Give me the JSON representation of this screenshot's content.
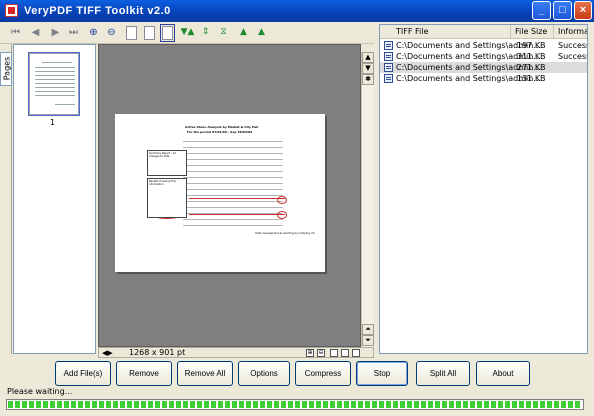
{
  "window": {
    "title": "VeryPDF TIFF Toolkit v2.0"
  },
  "side_tab": {
    "label": "Pages"
  },
  "thumbnail": {
    "page_number": "1"
  },
  "viewer": {
    "dimensions": "1268 x 901 pt"
  },
  "document": {
    "title": "Active Share Analysis by Market & City Pair",
    "subtitle": "For the period 07/01/99 - Sep 30/03/02",
    "box1": "Summary Report - 14 changes to date",
    "box2": "Benefit of having this information",
    "footer": "Data management & reporting by Company XX"
  },
  "file_list": {
    "columns": [
      "TIFF File",
      "File Size",
      "Information"
    ],
    "rows": [
      {
        "file": "C:\\Documents and Settings\\admin...",
        "size": "197 KB",
        "info": "Success",
        "selected": false
      },
      {
        "file": "C:\\Documents and Settings\\admin...",
        "size": "311 KB",
        "info": "Success",
        "selected": false
      },
      {
        "file": "C:\\Documents and Settings\\admin...",
        "size": "271 KB",
        "info": "",
        "selected": true
      },
      {
        "file": "C:\\Documents and Settings\\admin...",
        "size": "131 KB",
        "info": "",
        "selected": false
      }
    ]
  },
  "buttons": {
    "add_files": "Add File(s)",
    "remove": "Remove",
    "remove_all": "Remove All",
    "options": "Options",
    "compress": "Compress",
    "stop": "Stop",
    "split_all": "Split All",
    "about": "About"
  },
  "status": {
    "text": "Please waiting..."
  },
  "progress": {
    "percent": 100
  },
  "colors": {
    "titlebar": "#0842b8",
    "progress": "#3fcf34",
    "viewer_bg": "#7f7f7f"
  }
}
